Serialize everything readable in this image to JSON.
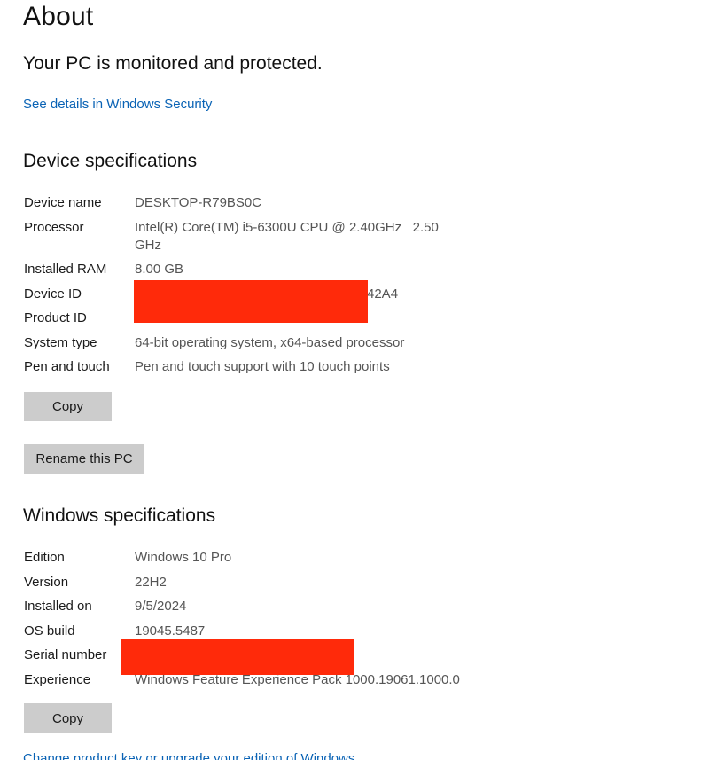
{
  "title": "About",
  "protection_status": "Your PC is monitored and protected.",
  "security_link": "See details in Windows Security",
  "device": {
    "heading": "Device specifications",
    "rows": [
      {
        "label": "Device name",
        "value": "DESKTOP-R79BS0C"
      },
      {
        "label": "Processor",
        "value": "Intel(R) Core(TM) i5-6300U CPU @ 2.40GHz   2.50 GHz"
      },
      {
        "label": "Installed RAM",
        "value": "8.00 GB"
      },
      {
        "label": "Device ID",
        "value": "42A4"
      },
      {
        "label": "Product ID",
        "value": ""
      },
      {
        "label": "System type",
        "value": "64-bit operating system, x64-based processor"
      },
      {
        "label": "Pen and touch",
        "value": "Pen and touch support with 10 touch points"
      }
    ],
    "copy_button": "Copy",
    "rename_button": "Rename this PC"
  },
  "windows": {
    "heading": "Windows specifications",
    "rows": [
      {
        "label": "Edition",
        "value": "Windows 10 Pro"
      },
      {
        "label": "Version",
        "value": "22H2"
      },
      {
        "label": "Installed on",
        "value": "9/5/2024"
      },
      {
        "label": "OS build",
        "value": "19045.5487"
      },
      {
        "label": "Serial number",
        "value": ""
      },
      {
        "label": "Experience",
        "value": "Windows Feature Experience Pack 1000.19061.1000.0"
      }
    ],
    "copy_button": "Copy"
  },
  "change_key_link": "Change product key or upgrade your edition of Windows",
  "colors": {
    "link": "#0a63b5",
    "button_bg": "#cccccc",
    "redaction": "#ff2a0a"
  }
}
